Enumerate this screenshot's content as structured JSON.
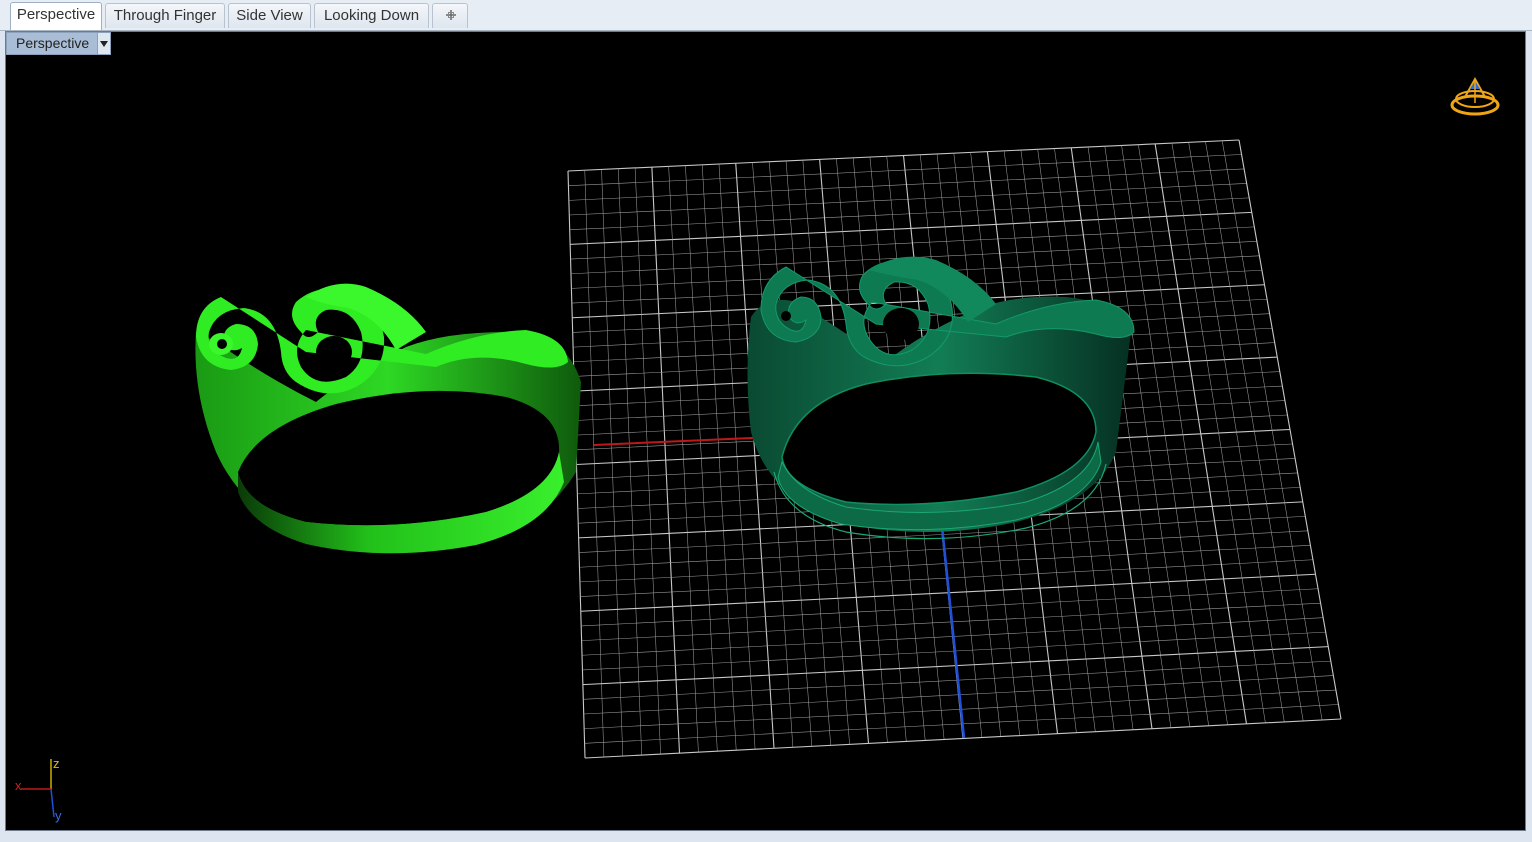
{
  "tabs": [
    {
      "label": "Perspective",
      "active": true
    },
    {
      "label": "Through Finger",
      "active": false
    },
    {
      "label": "Side View",
      "active": false
    },
    {
      "label": "Looking Down",
      "active": false
    }
  ],
  "viewport": {
    "title": "Perspective",
    "background": "#000000",
    "axis_labels": {
      "x": "x",
      "y": "y",
      "z": "z"
    }
  },
  "colors": {
    "ring_left": "#22e01a",
    "ring_right": "#0f7a52",
    "grid_line": "#9a9a9a",
    "grid_major": "#c8c8c8",
    "x_axis": "#c01818",
    "y_axis": "#1e50d8",
    "navigator": "#f0a614"
  }
}
